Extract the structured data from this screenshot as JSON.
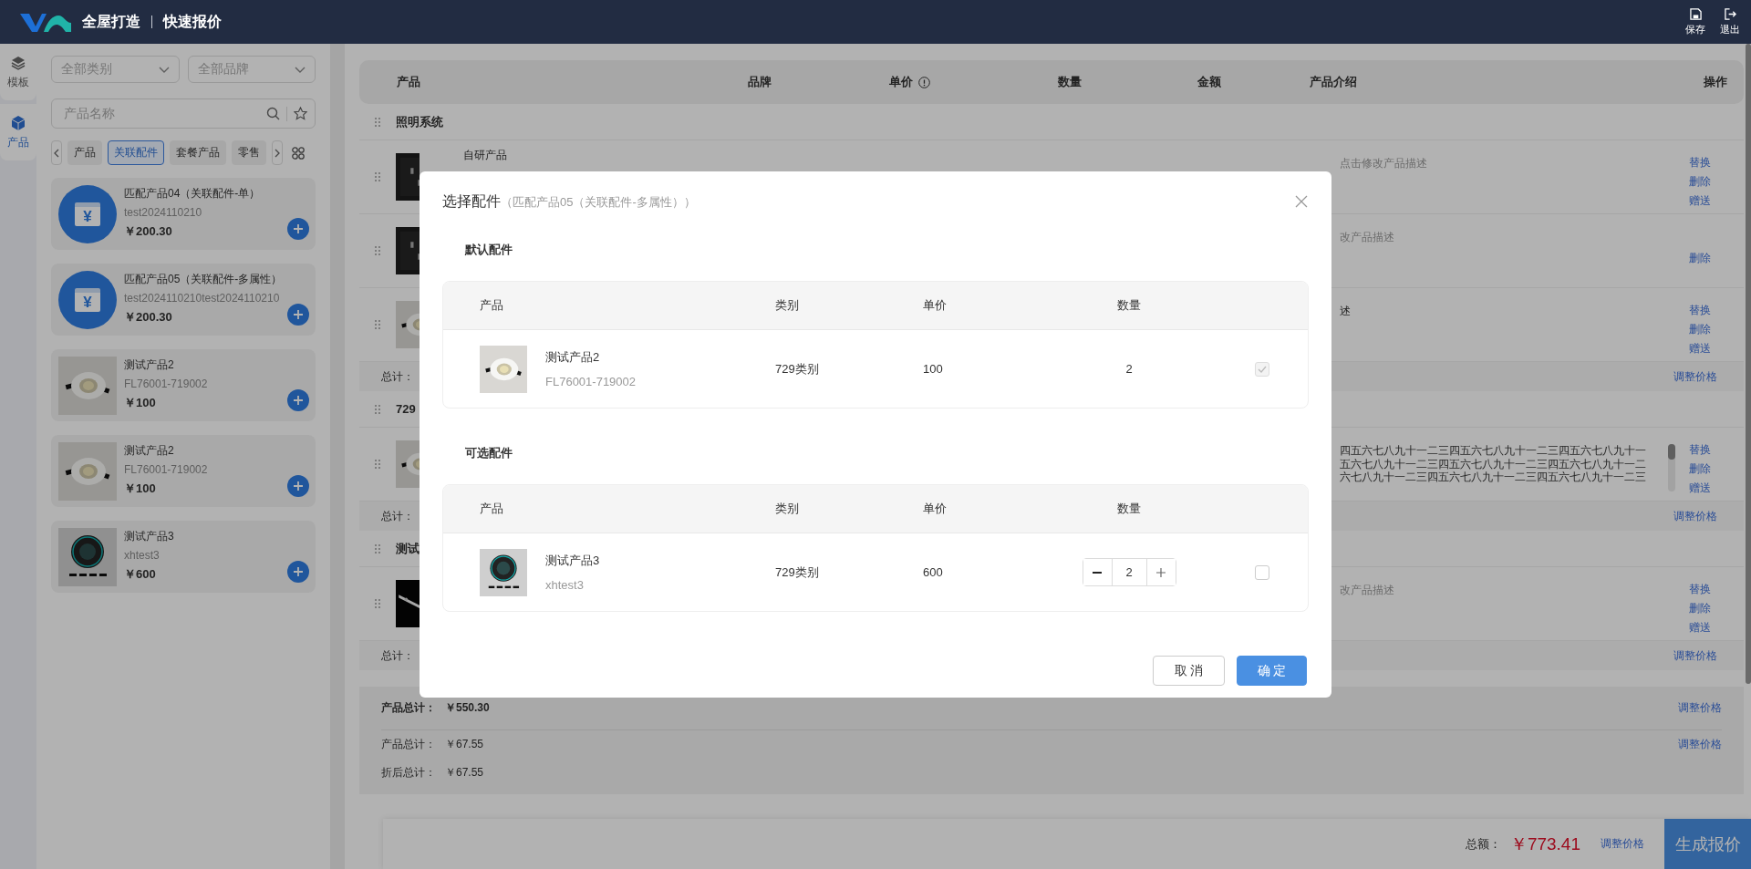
{
  "header": {
    "brand": "全屋打造",
    "page": "快速报价",
    "actions": [
      {
        "kind": "save",
        "label": "保存"
      },
      {
        "kind": "exit",
        "label": "退出"
      }
    ]
  },
  "rail": [
    {
      "kind": "layers",
      "label": "模板",
      "selected": false
    },
    {
      "kind": "cube",
      "label": "产品",
      "selected": true
    }
  ],
  "catalog": {
    "filters": [
      {
        "placeholder": "全部类别"
      },
      {
        "placeholder": "全部品牌"
      }
    ],
    "search": {
      "placeholder": "产品名称"
    },
    "tabs": [
      {
        "label": "产品",
        "selected": false
      },
      {
        "label": "关联配件",
        "selected": true
      },
      {
        "label": "套餐产品",
        "selected": false
      },
      {
        "label": "零售",
        "selected": false
      }
    ],
    "items": [
      {
        "kind": "symbol",
        "glyph": "¥",
        "name": "匹配产品04（关联配件-单）",
        "code": "test2024110210",
        "price": "￥200.30"
      },
      {
        "kind": "symbol",
        "glyph": "¥",
        "name": "匹配产品05（关联配件-多属性）",
        "code": "test2024110210test2024110210",
        "price": "￥200.30"
      },
      {
        "name": "测试产品2",
        "code": "FL76001-719002",
        "price": "￥100"
      },
      {
        "name": "测试产品2",
        "code": "FL76001-719002",
        "price": "￥100"
      },
      {
        "name": "测试产品3",
        "code": "xhtest3",
        "price": "￥600"
      }
    ]
  },
  "quote": {
    "columns": [
      {
        "label": "产品"
      },
      {
        "label": "品牌"
      },
      {
        "label": "单价",
        "info": true
      },
      {
        "label": "数量"
      },
      {
        "label": "金额"
      },
      {
        "label": "产品介绍"
      },
      {
        "label": "操作"
      }
    ],
    "groups": [
      {
        "title": "照明系统",
        "rows": [
          {
            "name": "自研产品",
            "description": {
              "kind": "hint",
              "lines": [
                "点击修改产品描述"
              ]
            },
            "actions": [
              "替换",
              "删除",
              "赠送"
            ]
          },
          {
            "description": {
              "kind": "hint",
              "lines": [
                "改产品描述"
              ]
            },
            "actions": [
              "删除"
            ]
          },
          {
            "description": {
              "kind": "text",
              "lines": [
                "述"
              ]
            },
            "actions": [
              "替换",
              "删除",
              "赠送"
            ]
          }
        ],
        "total": {
          "label": "总计：",
          "action": "调整价格"
        }
      },
      {
        "title": "729",
        "rows": [
          {
            "description": {
              "kind": "long",
              "lines": [
                "四五六七八九十一二三四五六七八九十一二三四五六七八九十一",
                "五六七八九十一二三四五六七八九十一二三四五六七八九十一二",
                "六七八九十一二三四五六七八九十一二三四五六七八九十一二三"
              ]
            },
            "actions": [
              "替换",
              "删除",
              "赠送"
            ]
          }
        ],
        "total": {
          "label": "总计：",
          "action": "调整价格"
        }
      },
      {
        "title": "测试",
        "rows": [
          {
            "description": {
              "kind": "hint",
              "lines": [
                "改产品描述"
              ]
            },
            "actions": [
              "替换",
              "删除",
              "赠送"
            ]
          }
        ],
        "total": {
          "label": "总计：",
          "action": "调整价格"
        }
      }
    ]
  },
  "summary": [
    {
      "label": "产品总计：",
      "value": "￥550.30",
      "bold": true,
      "action": "调整价格"
    },
    {
      "label": "产品总计：",
      "value": "￥67.55",
      "bold": false,
      "action": "调整价格"
    },
    {
      "label": "折后总计：",
      "value": "￥67.55",
      "bold": false
    }
  ],
  "footer": {
    "total_label": "总额：",
    "total": "￥773.41",
    "action": "调整价格",
    "submit": "生成报价"
  },
  "modal": {
    "title": "选择配件",
    "subtitle": "（匹配产品05（关联配件-多属性））",
    "sections": [
      {
        "title": "默认配件",
        "columns": [
          "产品",
          "类别",
          "单价",
          "数量"
        ],
        "rows": [
          {
            "name": "测试产品2",
            "code": "FL76001-719002",
            "category": "729类别",
            "price": "100",
            "quantity": "2",
            "editable": false,
            "checked": true,
            "disabled": true
          }
        ]
      },
      {
        "title": "可选配件",
        "columns": [
          "产品",
          "类别",
          "单价",
          "数量"
        ],
        "rows": [
          {
            "name": "测试产品3",
            "code": "xhtest3",
            "category": "729类别",
            "price": "600",
            "quantity": "2",
            "editable": true,
            "checked": false,
            "disabled": false
          }
        ]
      }
    ],
    "buttons": [
      {
        "kind": "secondary",
        "label": "取 消"
      },
      {
        "kind": "primary",
        "label": "确 定"
      }
    ]
  }
}
